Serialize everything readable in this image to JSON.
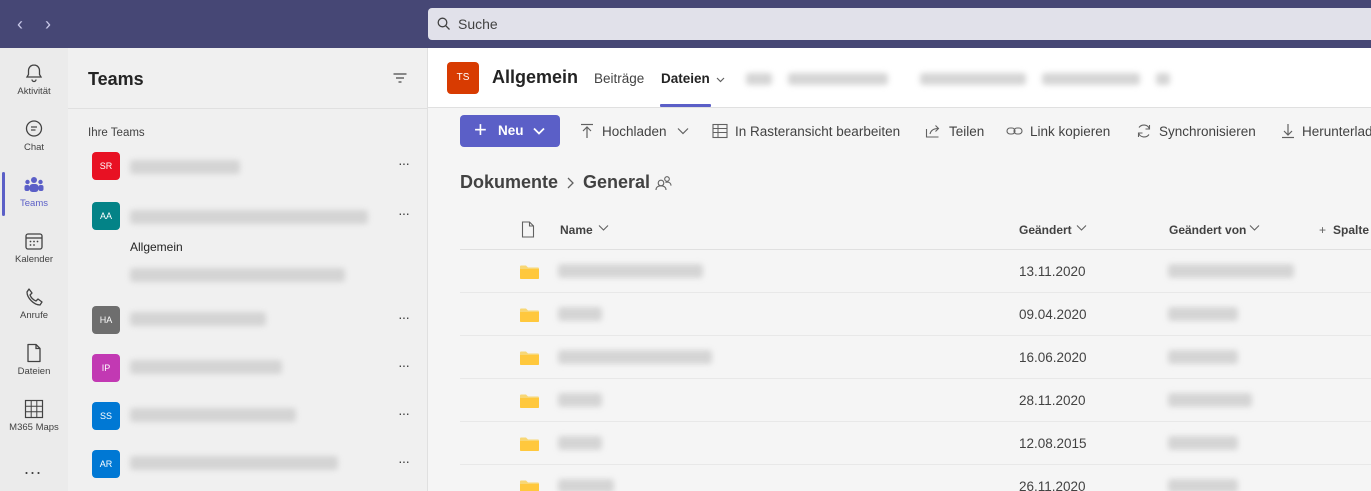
{
  "search": {
    "placeholder": "Suche"
  },
  "rail": {
    "items": [
      {
        "label": "Aktivität",
        "icon": "bell-icon"
      },
      {
        "label": "Chat",
        "icon": "chat-icon"
      },
      {
        "label": "Teams",
        "icon": "teams-icon",
        "active": true
      },
      {
        "label": "Kalender",
        "icon": "calendar-icon"
      },
      {
        "label": "Anrufe",
        "icon": "phone-icon"
      },
      {
        "label": "Dateien",
        "icon": "file-icon"
      },
      {
        "label": "M365 Maps",
        "icon": "grid-icon"
      }
    ],
    "more": "..."
  },
  "teams_panel": {
    "title": "Teams",
    "section": "Ihre Teams",
    "teams": [
      {
        "initials": "SR",
        "color": "#e81123"
      },
      {
        "initials": "AA",
        "color": "#038387"
      },
      {
        "initials": "HA",
        "color": "#6e6e6e"
      },
      {
        "initials": "IP",
        "color": "#c239b3"
      },
      {
        "initials": "SS",
        "color": "#0078d4"
      },
      {
        "initials": "AR",
        "color": "#0078d4"
      }
    ],
    "channels": [
      "Allgemein"
    ]
  },
  "header": {
    "avatar": "TS",
    "channel_name": "Allgemein",
    "tabs": {
      "posts": "Beiträge",
      "files": "Dateien"
    }
  },
  "toolbar": {
    "new": "Neu",
    "upload": "Hochladen",
    "grid_edit": "In Rasteransicht bearbeiten",
    "share": "Teilen",
    "copy_link": "Link kopieren",
    "sync": "Synchronisieren",
    "download": "Herunterlad"
  },
  "breadcrumb": {
    "root": "Dokumente",
    "current": "General"
  },
  "grid": {
    "columns": {
      "name": "Name",
      "modified": "Geändert",
      "modified_by": "Geändert von",
      "add_column": "Spalte"
    },
    "rows": [
      {
        "date": "13.11.2020"
      },
      {
        "date": "09.04.2020"
      },
      {
        "date": "16.06.2020"
      },
      {
        "date": "28.11.2020"
      },
      {
        "date": "12.08.2015"
      },
      {
        "date": "26.11.2020"
      }
    ]
  },
  "colors": {
    "accent": "#5b5fc7",
    "topbar": "#464775",
    "folder": "#f8d775"
  }
}
